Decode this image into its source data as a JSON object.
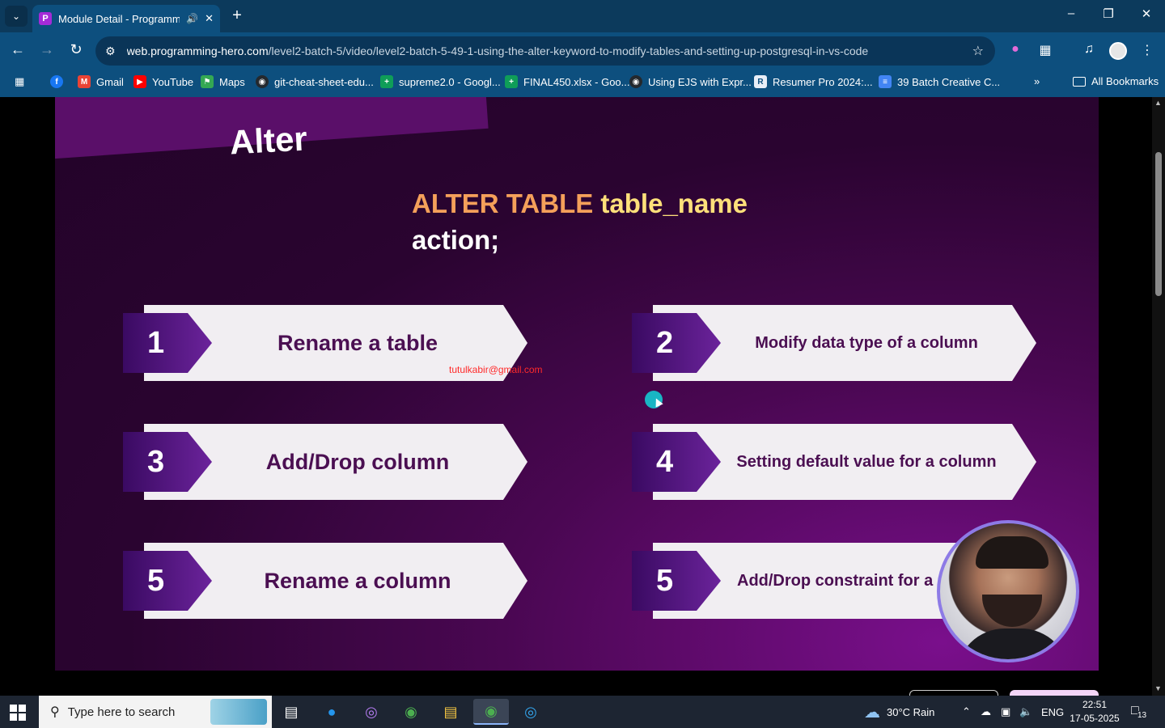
{
  "browser": {
    "tab_title": "Module Detail - Programmi",
    "url_host": "web.programming-hero.com",
    "url_path": "/level2-batch-5/video/level2-batch-5-49-1-using-the-alter-keyword-to-modify-tables-and-setting-up-postgresql-in-vs-code",
    "bookmarks": [
      {
        "label": "Gmail",
        "icon": "gmail-icon",
        "color": "#ea4335"
      },
      {
        "label": "YouTube",
        "icon": "youtube-icon",
        "color": "#ff0000"
      },
      {
        "label": "Maps",
        "icon": "maps-icon",
        "color": "#34a853"
      },
      {
        "label": "git-cheat-sheet-edu...",
        "icon": "github-icon",
        "color": "#24292e"
      },
      {
        "label": "supreme2.0 - Googl...",
        "icon": "sheets-icon",
        "color": "#0f9d58"
      },
      {
        "label": "FINAL450.xlsx - Goo...",
        "icon": "sheets-icon",
        "color": "#0f9d58"
      },
      {
        "label": "Using EJS with Expr...",
        "icon": "github-icon",
        "color": "#24292e"
      },
      {
        "label": "Resumer Pro 2024:...",
        "icon": "resumer-icon",
        "color": "#e8eef7"
      },
      {
        "label": "39 Batch Creative C...",
        "icon": "docs-icon",
        "color": "#4285f4"
      }
    ],
    "all_bookmarks": "All Bookmarks"
  },
  "slide": {
    "title": "Alter",
    "syntax_keyword": "ALTER TABLE",
    "syntax_identifier": "table_name",
    "syntax_line2": "action;",
    "watermark": "tutulkabir@gmail.com",
    "items": [
      {
        "number": "1",
        "label": "Rename a table"
      },
      {
        "number": "2",
        "label": "Modify data type  of a column"
      },
      {
        "number": "3",
        "label": "Add/Drop column"
      },
      {
        "number": "4",
        "label": "Setting default value for a column"
      },
      {
        "number": "5",
        "label": "Rename a column"
      },
      {
        "number": "5",
        "label": "Add/Drop constraint for a"
      }
    ],
    "colors": {
      "keyword": "#f4a05a",
      "identifier": "#ffe07a",
      "label": "#4b0f52"
    }
  },
  "taskbar": {
    "search_placeholder": "Type here to search",
    "weather": "30°C  Rain",
    "language": "ENG",
    "time": "22:51",
    "date": "17-05-2025",
    "notifications": "13"
  }
}
